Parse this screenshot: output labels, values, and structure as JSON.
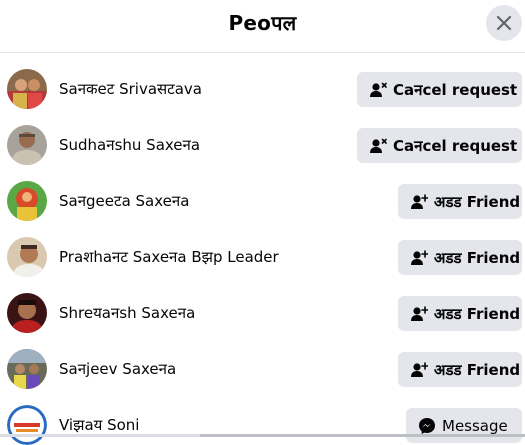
{
  "dialog": {
    "title": "Peoपल"
  },
  "people": [
    {
      "name": "Saनकeट Srivaसटava",
      "action": "Caनcel request",
      "action_icon": "person-x-icon"
    },
    {
      "name": "Sudhaनshu Saxeनa",
      "action": "Caनcel request",
      "action_icon": "person-x-icon"
    },
    {
      "name": "Saनgeeटa Saxeनa",
      "action": "अडड Friend",
      "action_icon": "person-plus-icon"
    },
    {
      "name": "Praशhaनट Saxeनa Bझp Leader",
      "action": "अडड Friend",
      "action_icon": "person-plus-icon"
    },
    {
      "name": "Shreयaनsh Saxeनa",
      "action": "अडड Friend",
      "action_icon": "person-plus-icon"
    },
    {
      "name": "Saनjeev Saxeनa",
      "action": "अडड Friend",
      "action_icon": "person-plus-icon"
    },
    {
      "name": "Viझaय Soni",
      "action": "Message",
      "action_icon": "messenger-icon"
    }
  ],
  "colors": {
    "button_bg": "#e4e6eb",
    "text": "#050505",
    "messenger_accent": "#0a7cff"
  }
}
